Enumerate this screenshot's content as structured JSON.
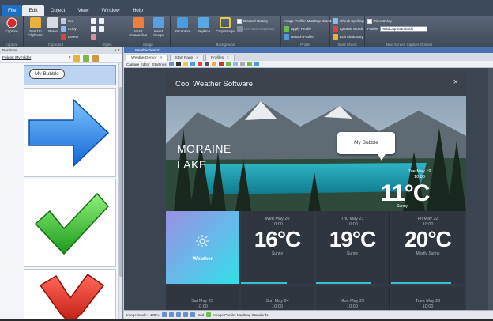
{
  "menu": {
    "file": "File",
    "tabs": [
      "Edit",
      "Object",
      "View",
      "Window",
      "Help"
    ],
    "active_index": 0
  },
  "ribbon": {
    "groups": [
      {
        "label": "Capture",
        "buttons": [
          {
            "label": "Capture",
            "icon": "record-icon",
            "color": "#d9272e"
          }
        ]
      },
      {
        "label": "Clipboard",
        "buttons": [
          {
            "label": "Send to Clipboard",
            "icon": "clipboard-icon",
            "color": "#e8b13b"
          },
          {
            "label": "Paste",
            "icon": "paste-icon",
            "color": "#d7dce3"
          }
        ],
        "small": [
          {
            "label": "Cut",
            "icon": "scissors-icon"
          },
          {
            "label": "Copy",
            "icon": "copy-icon"
          },
          {
            "label": "Delete",
            "icon": "delete-icon"
          }
        ]
      },
      {
        "label": "Styles",
        "buttons": [
          {
            "label": "",
            "icon": "style-icon",
            "color": "#e6e9ee"
          }
        ]
      },
      {
        "label": "Image",
        "buttons": [
          {
            "label": "Smart Screenshot",
            "icon": "screenshot-icon",
            "color": "#ef7d3b"
          },
          {
            "label": "Insert Image",
            "icon": "insert-image-icon",
            "color": "#5aa0e0"
          }
        ]
      },
      {
        "label": "Background",
        "buttons": [
          {
            "label": "Recapture",
            "icon": "recapture-icon",
            "color": "#4a9be0"
          },
          {
            "label": "Replace",
            "icon": "replace-icon",
            "color": "#58a8e4"
          },
          {
            "label": "Crop Image",
            "icon": "crop-icon",
            "color": "#e6c84c"
          }
        ],
        "small": [
          {
            "label": "Discard History",
            "icon": "checkbox-icon"
          },
          {
            "label": "Remove Image Bg",
            "icon": "remove-bg-icon"
          }
        ]
      },
      {
        "label": "Profile",
        "small": [
          {
            "label": "Image Profile: MadCap Stand...",
            "icon": ""
          },
          {
            "label": "Apply Profile",
            "icon": "apply-profile-icon"
          },
          {
            "label": "Detach Profile",
            "icon": "detach-profile-icon"
          }
        ]
      },
      {
        "label": "Spell Check",
        "small": [
          {
            "label": "Check Spelling",
            "icon": "spell-icon"
          },
          {
            "label": "Ignored Words",
            "icon": "ignored-icon"
          },
          {
            "label": "Edit Dictionary",
            "icon": "dictionary-icon"
          }
        ]
      },
      {
        "label": "New Screen Capture Options",
        "small": [
          {
            "label": "Time Delay",
            "icon": "checkbox-icon"
          },
          {
            "label": "Profile:",
            "icon": "",
            "combo": "MadCap Standards"
          }
        ]
      }
    ]
  },
  "left_panel": {
    "title": "Positions",
    "path": "Folder: MyFolder",
    "thumbnails": [
      {
        "kind": "bubble",
        "label": "My Bubble",
        "selected": true
      },
      {
        "kind": "arrow",
        "selected": false
      },
      {
        "kind": "check",
        "selected": false
      },
      {
        "kind": "cross",
        "selected": false
      }
    ]
  },
  "document": {
    "strip": "WeatherDemo*",
    "tabs": [
      {
        "label": "WeatherDemo*",
        "close": "×",
        "active": true
      },
      {
        "label": "Start Page",
        "close": "×",
        "active": false
      },
      {
        "label": "Profiles",
        "close": "×",
        "active": false
      }
    ],
    "editor_label": "Capture Editor",
    "editor_mode": "Startings"
  },
  "app_window": {
    "title": "Cool Weather Software",
    "close": "×",
    "location_line1": "MORAINE",
    "location_line2": "LAKE",
    "bubble": "My Bubble",
    "today": {
      "date": "Tue May 19",
      "time": "10:00",
      "temp": "11°C",
      "condition": "Sunny"
    },
    "weather_tile": "Weather",
    "forecast": [
      {
        "date": "Wed May 20",
        "time": "10:00",
        "temp": "16°C",
        "condition": "Sunny"
      },
      {
        "date": "Thu May 21",
        "time": "10:00",
        "temp": "19°C",
        "condition": "Sunny"
      },
      {
        "date": "Fri May 22",
        "time": "10:00",
        "temp": "20°C",
        "condition": "Mostly Sunny"
      }
    ],
    "forecast_row2": [
      {
        "date": "Sat May 23",
        "time": "10:00"
      },
      {
        "date": "Sun May 24",
        "time": "10:00"
      },
      {
        "date": "Mon May 25",
        "time": "10:00"
      },
      {
        "date": "Tues May 26",
        "time": "10:00"
      }
    ]
  },
  "status_bar": {
    "scale_label": "Image Scale:",
    "scale_value": "100%",
    "grid_label": "Grid",
    "profile": "Image Profile: MadCap Standards"
  },
  "colors": {
    "accent": "#1f6fc5",
    "forecast_bar": "#37c2d6",
    "lake": "#1aa7b8"
  }
}
